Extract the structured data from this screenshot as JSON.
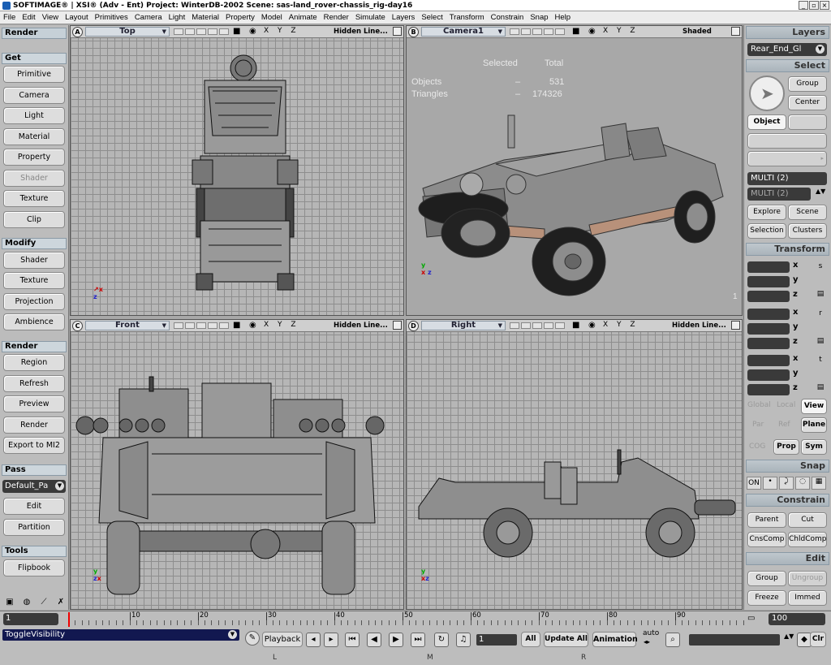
{
  "window": {
    "title": "SOFTIMAGE® | XSI® (Adv - Ent) Project: WinterDB-2002     Scene: sas-land_rover-chassis_rig-day16",
    "buttons": [
      "_",
      "▫",
      "×"
    ]
  },
  "menu": [
    "File",
    "Edit",
    "View",
    "Layout",
    "Primitives",
    "Camera",
    "Light",
    "Material",
    "Property",
    "Model",
    "Animate",
    "Render",
    "Simulate",
    "Layers",
    "Select",
    "Transform",
    "Constrain",
    "Snap",
    "Help"
  ],
  "left": {
    "toolbar_label": "Render",
    "get_header": "Get",
    "get_items": [
      "Primitive",
      "Camera",
      "Light",
      "Material",
      "Property",
      "Shader",
      "Texture",
      "Clip"
    ],
    "modify_header": "Modify",
    "modify_items": [
      "Shader",
      "Texture",
      "Projection",
      "Ambience"
    ],
    "render_header": "Render",
    "render_items": [
      "Region",
      "Refresh",
      "Preview",
      "Render",
      "Export to MI2"
    ],
    "pass_header": "Pass",
    "pass_value": "Default_Pa",
    "pass_items": [
      "Edit",
      "Partition"
    ],
    "tools_header": "Tools",
    "tools_items": [
      "Flipbook"
    ]
  },
  "viewports": {
    "a": {
      "letter": "A",
      "name": "Top",
      "mode": "Hidden Line..."
    },
    "b": {
      "letter": "B",
      "name": "Camera1",
      "mode": "Shaded"
    },
    "c": {
      "letter": "C",
      "name": "Front",
      "mode": "Hidden Line..."
    },
    "d": {
      "letter": "D",
      "name": "Right",
      "mode": "Hidden Line..."
    },
    "xyz": "X Y Z"
  },
  "stats": {
    "selected_label": "Selected",
    "total_label": "Total",
    "objects_label": "Objects",
    "objects_selected": "–",
    "objects_total": "531",
    "triangles_label": "Triangles",
    "triangles_selected": "–",
    "triangles_total": "174326",
    "corner": "1"
  },
  "right": {
    "layers_header": "Layers",
    "layer_value": "Rear_End_Gl",
    "select_header": "Select",
    "group": "Group",
    "center": "Center",
    "object": "Object",
    "multi1": "MULTI (2)",
    "multi2": "MULTI (2)",
    "explore": "Explore",
    "scene": "Scene",
    "selection": "Selection",
    "clusters": "Clusters",
    "transform_header": "Transform",
    "axes": [
      "x",
      "y",
      "z"
    ],
    "knobs": [
      "s",
      "r",
      "t"
    ],
    "global": "Global",
    "local": "Local",
    "view": "View",
    "par": "Par",
    "ref": "Ref",
    "plane": "Plane",
    "cog": "COG",
    "prop": "Prop",
    "sym": "Sym",
    "snap_header": "Snap",
    "snap_on": "ON",
    "constrain_header": "Constrain",
    "parent": "Parent",
    "cut": "Cut",
    "cnscomp": "CnsComp",
    "chldcomp": "ChldComp",
    "edit_header": "Edit",
    "edit_group": "Group",
    "ungroup": "Ungroup",
    "freeze": "Freeze",
    "immed": "Immed"
  },
  "timeline": {
    "start": "1",
    "end": "100",
    "ticks": [
      "10",
      "20",
      "30",
      "40",
      "50",
      "60",
      "70",
      "80",
      "90"
    ]
  },
  "bottom": {
    "command": "ToggleVisibility",
    "playback": "Playback",
    "current_frame": "1",
    "all": "All",
    "update_all": "Update All",
    "animation": "Animation",
    "auto": "auto",
    "clr": "Clr",
    "lmr": [
      "L",
      "M",
      "R"
    ]
  }
}
